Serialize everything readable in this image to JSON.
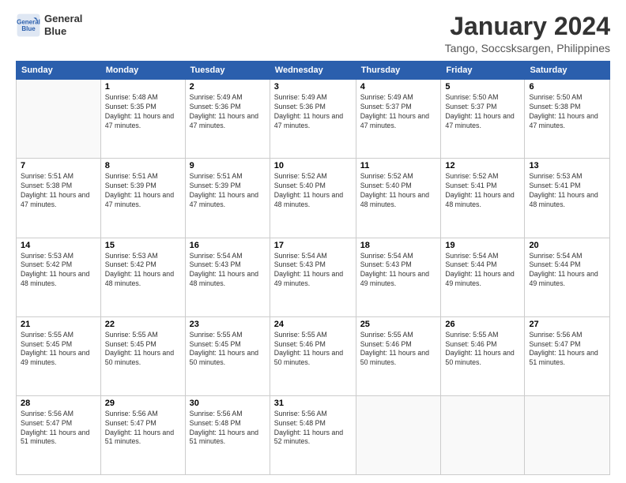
{
  "logo": {
    "line1": "General",
    "line2": "Blue"
  },
  "title": "January 2024",
  "subtitle": "Tango, Soccsksargen, Philippines",
  "days_header": [
    "Sunday",
    "Monday",
    "Tuesday",
    "Wednesday",
    "Thursday",
    "Friday",
    "Saturday"
  ],
  "weeks": [
    [
      {
        "num": "",
        "empty": true
      },
      {
        "num": "1",
        "sunrise": "5:48 AM",
        "sunset": "5:35 PM",
        "daylight": "11 hours and 47 minutes."
      },
      {
        "num": "2",
        "sunrise": "5:49 AM",
        "sunset": "5:36 PM",
        "daylight": "11 hours and 47 minutes."
      },
      {
        "num": "3",
        "sunrise": "5:49 AM",
        "sunset": "5:36 PM",
        "daylight": "11 hours and 47 minutes."
      },
      {
        "num": "4",
        "sunrise": "5:49 AM",
        "sunset": "5:37 PM",
        "daylight": "11 hours and 47 minutes."
      },
      {
        "num": "5",
        "sunrise": "5:50 AM",
        "sunset": "5:37 PM",
        "daylight": "11 hours and 47 minutes."
      },
      {
        "num": "6",
        "sunrise": "5:50 AM",
        "sunset": "5:38 PM",
        "daylight": "11 hours and 47 minutes."
      }
    ],
    [
      {
        "num": "7",
        "sunrise": "5:51 AM",
        "sunset": "5:38 PM",
        "daylight": "11 hours and 47 minutes."
      },
      {
        "num": "8",
        "sunrise": "5:51 AM",
        "sunset": "5:39 PM",
        "daylight": "11 hours and 47 minutes."
      },
      {
        "num": "9",
        "sunrise": "5:51 AM",
        "sunset": "5:39 PM",
        "daylight": "11 hours and 47 minutes."
      },
      {
        "num": "10",
        "sunrise": "5:52 AM",
        "sunset": "5:40 PM",
        "daylight": "11 hours and 48 minutes."
      },
      {
        "num": "11",
        "sunrise": "5:52 AM",
        "sunset": "5:40 PM",
        "daylight": "11 hours and 48 minutes."
      },
      {
        "num": "12",
        "sunrise": "5:52 AM",
        "sunset": "5:41 PM",
        "daylight": "11 hours and 48 minutes."
      },
      {
        "num": "13",
        "sunrise": "5:53 AM",
        "sunset": "5:41 PM",
        "daylight": "11 hours and 48 minutes."
      }
    ],
    [
      {
        "num": "14",
        "sunrise": "5:53 AM",
        "sunset": "5:42 PM",
        "daylight": "11 hours and 48 minutes."
      },
      {
        "num": "15",
        "sunrise": "5:53 AM",
        "sunset": "5:42 PM",
        "daylight": "11 hours and 48 minutes."
      },
      {
        "num": "16",
        "sunrise": "5:54 AM",
        "sunset": "5:43 PM",
        "daylight": "11 hours and 48 minutes."
      },
      {
        "num": "17",
        "sunrise": "5:54 AM",
        "sunset": "5:43 PM",
        "daylight": "11 hours and 49 minutes."
      },
      {
        "num": "18",
        "sunrise": "5:54 AM",
        "sunset": "5:43 PM",
        "daylight": "11 hours and 49 minutes."
      },
      {
        "num": "19",
        "sunrise": "5:54 AM",
        "sunset": "5:44 PM",
        "daylight": "11 hours and 49 minutes."
      },
      {
        "num": "20",
        "sunrise": "5:54 AM",
        "sunset": "5:44 PM",
        "daylight": "11 hours and 49 minutes."
      }
    ],
    [
      {
        "num": "21",
        "sunrise": "5:55 AM",
        "sunset": "5:45 PM",
        "daylight": "11 hours and 49 minutes."
      },
      {
        "num": "22",
        "sunrise": "5:55 AM",
        "sunset": "5:45 PM",
        "daylight": "11 hours and 50 minutes."
      },
      {
        "num": "23",
        "sunrise": "5:55 AM",
        "sunset": "5:45 PM",
        "daylight": "11 hours and 50 minutes."
      },
      {
        "num": "24",
        "sunrise": "5:55 AM",
        "sunset": "5:46 PM",
        "daylight": "11 hours and 50 minutes."
      },
      {
        "num": "25",
        "sunrise": "5:55 AM",
        "sunset": "5:46 PM",
        "daylight": "11 hours and 50 minutes."
      },
      {
        "num": "26",
        "sunrise": "5:55 AM",
        "sunset": "5:46 PM",
        "daylight": "11 hours and 50 minutes."
      },
      {
        "num": "27",
        "sunrise": "5:56 AM",
        "sunset": "5:47 PM",
        "daylight": "11 hours and 51 minutes."
      }
    ],
    [
      {
        "num": "28",
        "sunrise": "5:56 AM",
        "sunset": "5:47 PM",
        "daylight": "11 hours and 51 minutes."
      },
      {
        "num": "29",
        "sunrise": "5:56 AM",
        "sunset": "5:47 PM",
        "daylight": "11 hours and 51 minutes."
      },
      {
        "num": "30",
        "sunrise": "5:56 AM",
        "sunset": "5:48 PM",
        "daylight": "11 hours and 51 minutes."
      },
      {
        "num": "31",
        "sunrise": "5:56 AM",
        "sunset": "5:48 PM",
        "daylight": "11 hours and 52 minutes."
      },
      {
        "num": "",
        "empty": true
      },
      {
        "num": "",
        "empty": true
      },
      {
        "num": "",
        "empty": true
      }
    ]
  ]
}
